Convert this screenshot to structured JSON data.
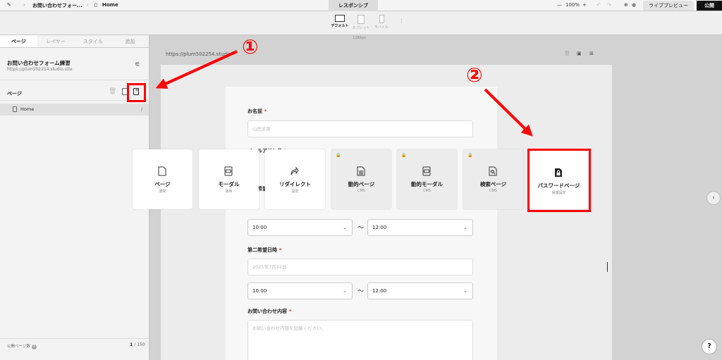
{
  "topbar": {
    "breadcrumb_project": "お問い合わせフォー...",
    "breadcrumb_page": "Home",
    "center_tab": "レスポンシブ",
    "zoom_minus": "—",
    "zoom_level": "100%",
    "zoom_plus": "+",
    "live_preview": "ライブプレビュー",
    "publish": "公開"
  },
  "devices": {
    "default": "デフォルト",
    "tablet": "タブレット",
    "mobile": "モバイル"
  },
  "canvas": {
    "width_label": "1280px",
    "url": "https://plum502254.studio"
  },
  "sidebar": {
    "tabs": [
      "ページ",
      "レイヤー",
      "スタイル",
      "追加"
    ],
    "project_title": "お問い合わせフォーム練習",
    "project_url": "https://plum502254.studio.site",
    "pages_label": "ページ",
    "home_label": "Home",
    "home_slash": "/",
    "public_pages_label": "公開ページ数",
    "public_pages_count": "1",
    "public_pages_total": "/ 150"
  },
  "form": {
    "name_label": "お名前",
    "name_placeholder": "山田太郎",
    "email_label": "メールアドレス",
    "first_wish_label": "第一希望日時",
    "time_from_1": "10:00",
    "time_to_1": "12:00",
    "second_wish_label": "第二希望日時",
    "second_wish_date": "2025年7月22日",
    "time_from_2": "10:00",
    "time_to_2": "12:00",
    "inquiry_label": "お問い合わせ内容",
    "inquiry_placeholder": "お問い合わせ内容を記載ください。",
    "required_mark": "*",
    "tilde": "〜"
  },
  "page_types": [
    {
      "title": "ページ",
      "sub": "通常"
    },
    {
      "title": "モーダル",
      "sub": "通常"
    },
    {
      "title": "リダイレクト",
      "sub": "設定"
    },
    {
      "title": "動的ページ",
      "sub": "CMS"
    },
    {
      "title": "動的モーダル",
      "sub": "CMS"
    },
    {
      "title": "検索ページ",
      "sub": "CMS"
    },
    {
      "title": "パスワードページ",
      "sub": "保護設定"
    }
  ],
  "annotations": {
    "step1": "①",
    "step2": "②",
    "color": "#ff0000"
  },
  "help": "?",
  "collapse": "‹"
}
